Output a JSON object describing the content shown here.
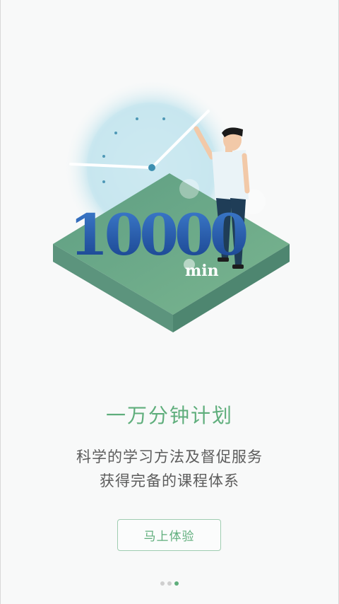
{
  "illustration": {
    "big_number": "10000",
    "unit": "min"
  },
  "headline": "一万分钟计划",
  "subtitle_lines": [
    "科学的学习方法及督促服务",
    "获得完备的课程体系"
  ],
  "cta_label": "马上体验",
  "pager": {
    "total": 3,
    "active_index": 2
  },
  "colors": {
    "accent": "#5fae7c",
    "platform_top": "#6aa88c",
    "number_blue": "#1f5fb0",
    "clock_glow": "#bfe3ee"
  }
}
